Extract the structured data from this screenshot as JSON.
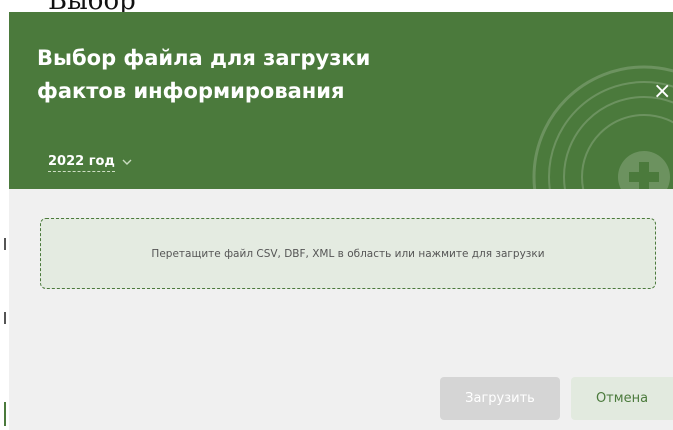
{
  "background_heading": {
    "text": "Выбор"
  },
  "modal": {
    "title": "Выбор файла для загрузки фактов информирования",
    "close_icon": "×",
    "year": {
      "selected": "2022 год",
      "icon": "chevron-down-icon"
    },
    "dropzone": {
      "text": "Перетащите файл CSV, DBF, XML в область или нажмите для загрузки"
    },
    "buttons": {
      "upload": "Загрузить",
      "cancel": "Отмена"
    }
  },
  "colors": {
    "header": "#4b7a3c",
    "body": "#f0f0f0",
    "dropzone_border": "#4b7a3c",
    "upload_disabled": "#d5d5d5",
    "cancel_bg": "#e2eadf"
  }
}
